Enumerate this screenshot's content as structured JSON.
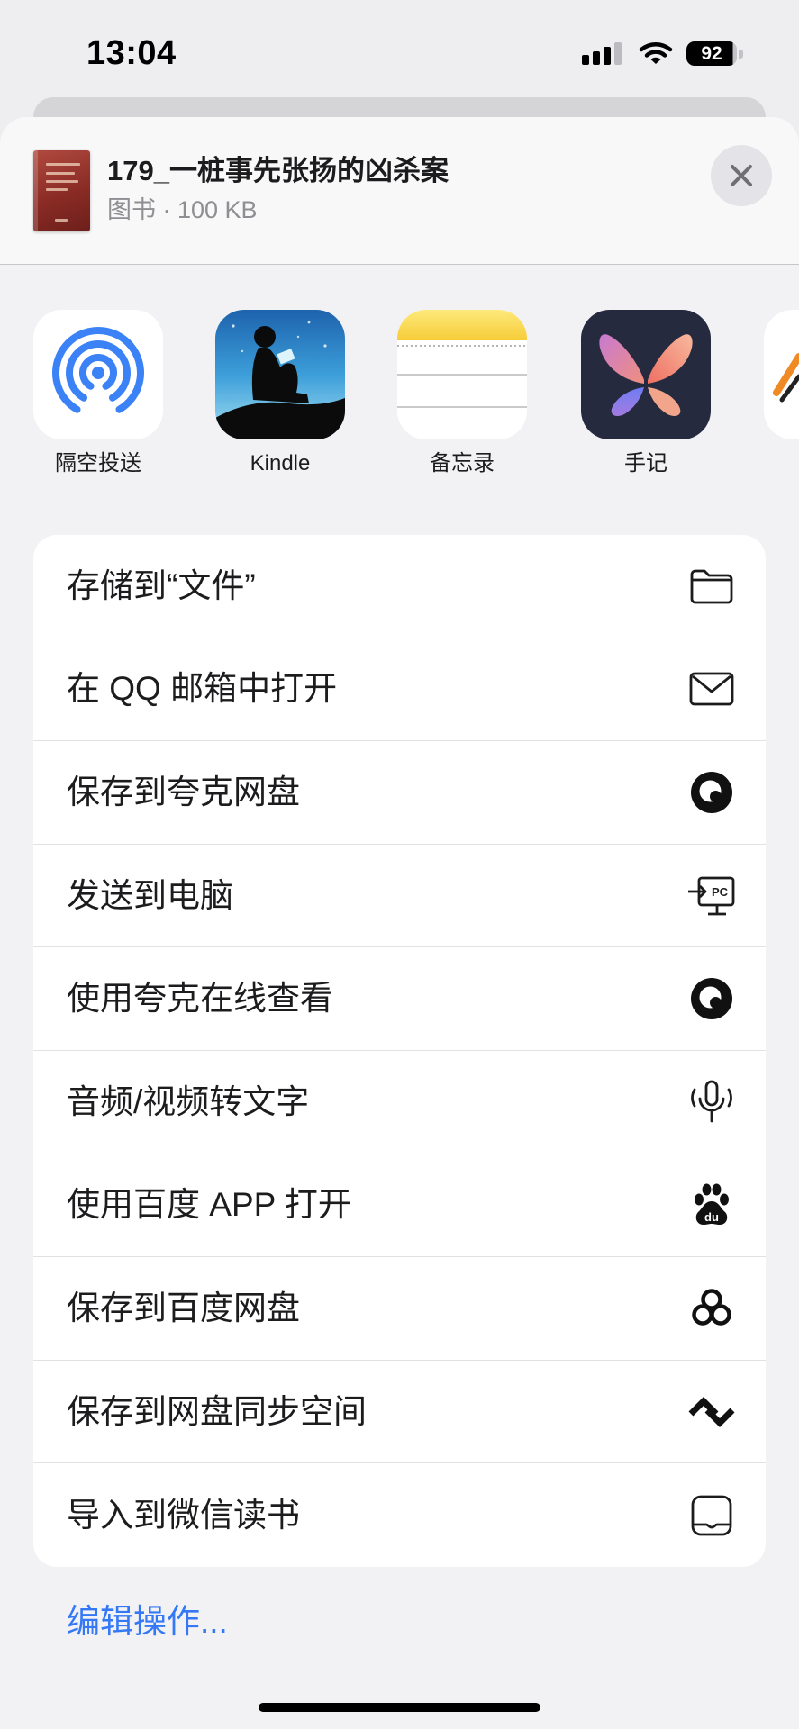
{
  "status_bar": {
    "time": "13:04",
    "battery_percent": "92",
    "signal_bars": 3,
    "signal_total": 4
  },
  "header": {
    "title": "179_一桩事先张扬的凶杀案",
    "subtitle": "图书 · 100 KB"
  },
  "apps": [
    {
      "label": "隔空投送",
      "icon": "airdrop-icon"
    },
    {
      "label": "Kindle",
      "icon": "kindle-icon"
    },
    {
      "label": "备忘录",
      "icon": "notes-icon"
    },
    {
      "label": "手记",
      "icon": "journal-icon"
    },
    {
      "icon": "app-icon-partial"
    }
  ],
  "actions": [
    {
      "label": "存储到“文件”",
      "icon": "folder-icon"
    },
    {
      "label": "在 QQ 邮箱中打开",
      "icon": "mail-icon"
    },
    {
      "label": "保存到夸克网盘",
      "icon": "quark-icon"
    },
    {
      "label": "发送到电脑",
      "icon": "pc-icon",
      "icon_text": "PC"
    },
    {
      "label": "使用夸克在线查看",
      "icon": "quark-icon"
    },
    {
      "label": "音频/视频转文字",
      "icon": "microphone-icon"
    },
    {
      "label": "使用百度 APP 打开",
      "icon": "baidu-icon",
      "icon_text": "du"
    },
    {
      "label": "保存到百度网盘",
      "icon": "baidu-netdisk-icon"
    },
    {
      "label": "保存到网盘同步空间",
      "icon": "sync-space-icon"
    },
    {
      "label": "导入到微信读书",
      "icon": "wechat-read-icon"
    }
  ],
  "edit_actions": "编辑操作...",
  "colors": {
    "accent": "#3478f6",
    "airdrop": "#3b82f6",
    "card": "#ffffff",
    "background": "#f2f2f4"
  }
}
